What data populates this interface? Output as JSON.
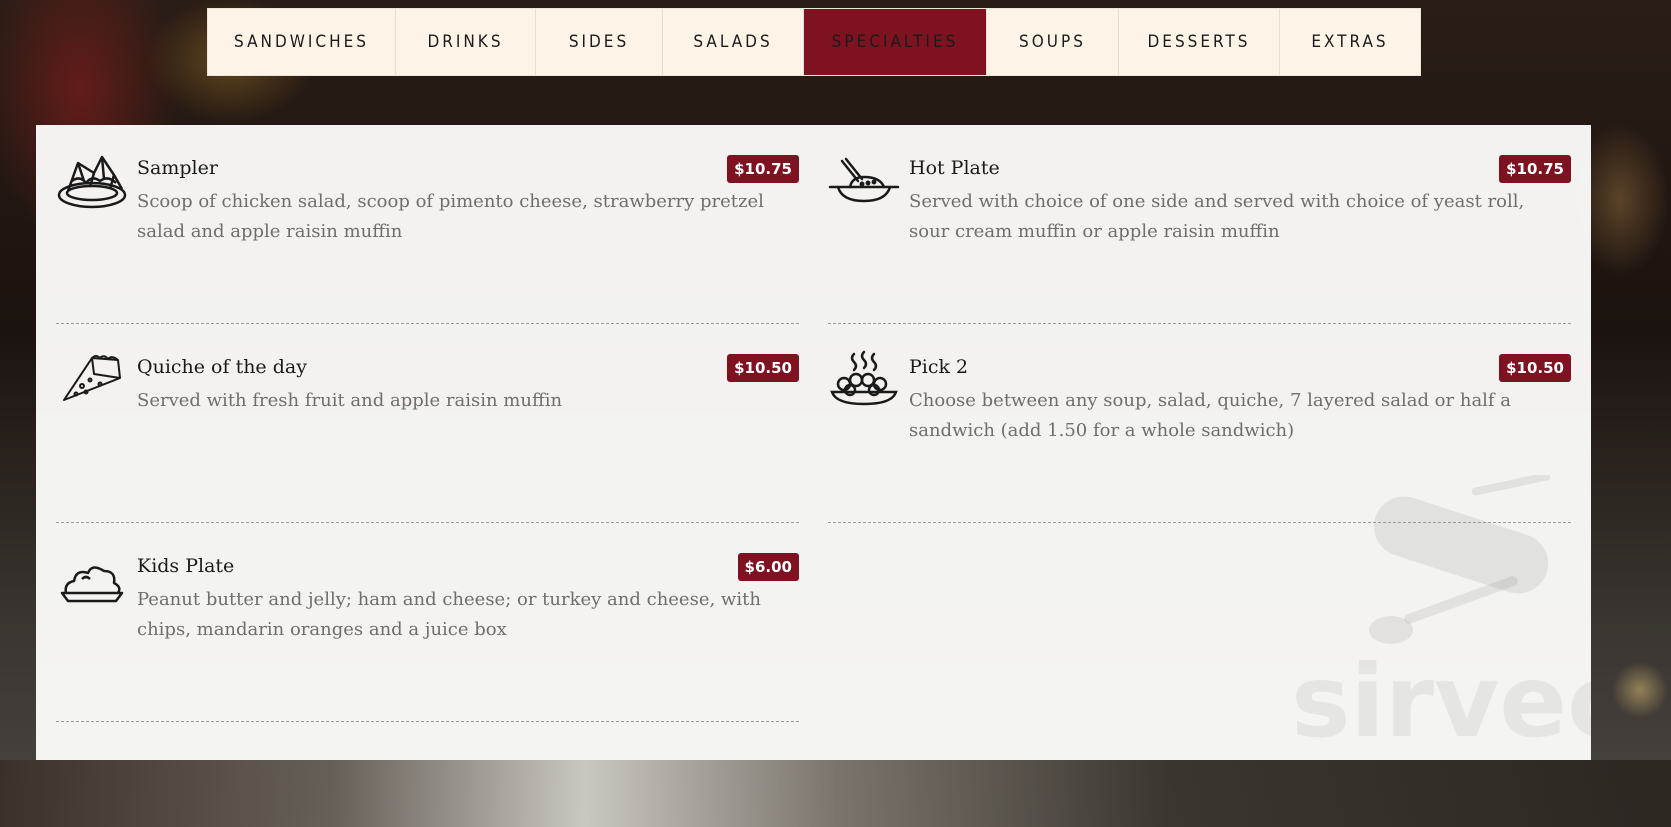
{
  "tabs": [
    {
      "label": "SANDWICHES",
      "active": false
    },
    {
      "label": "DRINKS",
      "active": false
    },
    {
      "label": "SIDES",
      "active": false
    },
    {
      "label": "SALADS",
      "active": false
    },
    {
      "label": "SPECIALTIES",
      "active": true
    },
    {
      "label": "SOUPS",
      "active": false
    },
    {
      "label": "DESSERTS",
      "active": false
    },
    {
      "label": "EXTRAS",
      "active": false
    }
  ],
  "items": [
    {
      "name": "Sampler",
      "price": "$10.75",
      "icon": "nachos-plate-icon",
      "description": "Scoop of chicken salad, scoop of pimento cheese, strawberry pretzel salad and apple raisin muffin"
    },
    {
      "name": "Hot Plate",
      "price": "$10.75",
      "icon": "rice-plate-icon",
      "description": "Served with choice of one side and served with choice of yeast roll, sour cream muffin or apple raisin muffin"
    },
    {
      "name": "Quiche of the day",
      "price": "$10.50",
      "icon": "pie-slice-icon",
      "description": "Served with fresh fruit and apple raisin muffin"
    },
    {
      "name": "Pick 2",
      "price": "$10.50",
      "icon": "hot-food-plate-icon",
      "description": "Choose between any soup, salad, quiche, 7 layered salad or half a sandwich (add 1.50 for a whole sandwich)"
    },
    {
      "name": "Kids Plate",
      "price": "$6.00",
      "icon": "covered-plate-icon",
      "description": "Peanut butter and jelly; ham and cheese; or turkey and cheese, with chips, mandarin oranges and a juice box"
    }
  ],
  "watermark": {
    "text": "sirvec",
    "icon": "utensil-knife-icon"
  },
  "colors": {
    "accent": "#7e1221",
    "tab_bg": "#fdf3e6",
    "panel_bg": "#f7f7f6"
  }
}
